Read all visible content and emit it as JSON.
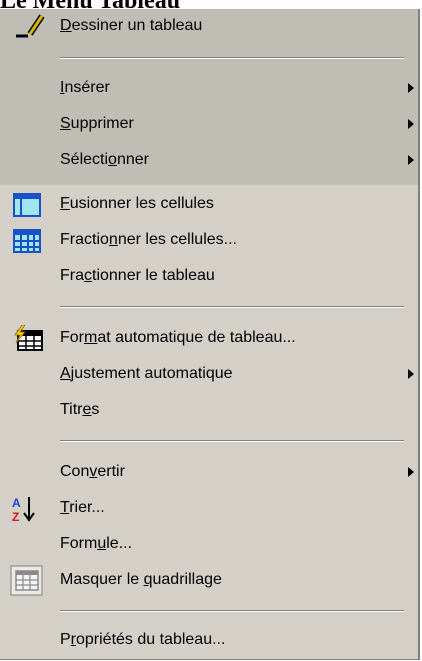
{
  "page": {
    "title": "Le Menu Tableau"
  },
  "menu": {
    "items": [
      {
        "pre": "",
        "u": "D",
        "post": "essiner un tableau"
      },
      {
        "pre": "",
        "u": "I",
        "post": "nsérer"
      },
      {
        "pre": "",
        "u": "S",
        "post": "upprimer"
      },
      {
        "pre": "Sélecti",
        "u": "o",
        "post": "nner"
      },
      {
        "pre": "",
        "u": "F",
        "post": "usionner les cellules"
      },
      {
        "pre": "Fractio",
        "u": "n",
        "post": "ner les cellules..."
      },
      {
        "pre": "Fra",
        "u": "c",
        "post": "tionner le tableau"
      },
      {
        "pre": "For",
        "u": "m",
        "post": "at automatique de tableau..."
      },
      {
        "pre": "",
        "u": "A",
        "post": "justement automatique"
      },
      {
        "pre": "Titr",
        "u": "e",
        "post": "s"
      },
      {
        "pre": "Con",
        "u": "v",
        "post": "ertir"
      },
      {
        "pre": "",
        "u": "T",
        "post": "rier..."
      },
      {
        "pre": "Form",
        "u": "u",
        "post": "le..."
      },
      {
        "pre": "Masquer le ",
        "u": "q",
        "post": "uadrillage"
      },
      {
        "pre": "P",
        "u": "r",
        "post": "opriétés du tableau..."
      }
    ]
  },
  "icons": {
    "draw": "pencil-icon",
    "merge": "merge-cells-icon",
    "split": "split-cells-icon",
    "autoformat": "table-autoformat-icon",
    "sort": "sort-az-icon",
    "gridlines": "gridlines-icon"
  },
  "colors": {
    "menu_bg": "#d4d0c8",
    "menu_shade": "#c0bdb5",
    "separator_dark": "#808080",
    "separator_light": "#ffffff"
  }
}
